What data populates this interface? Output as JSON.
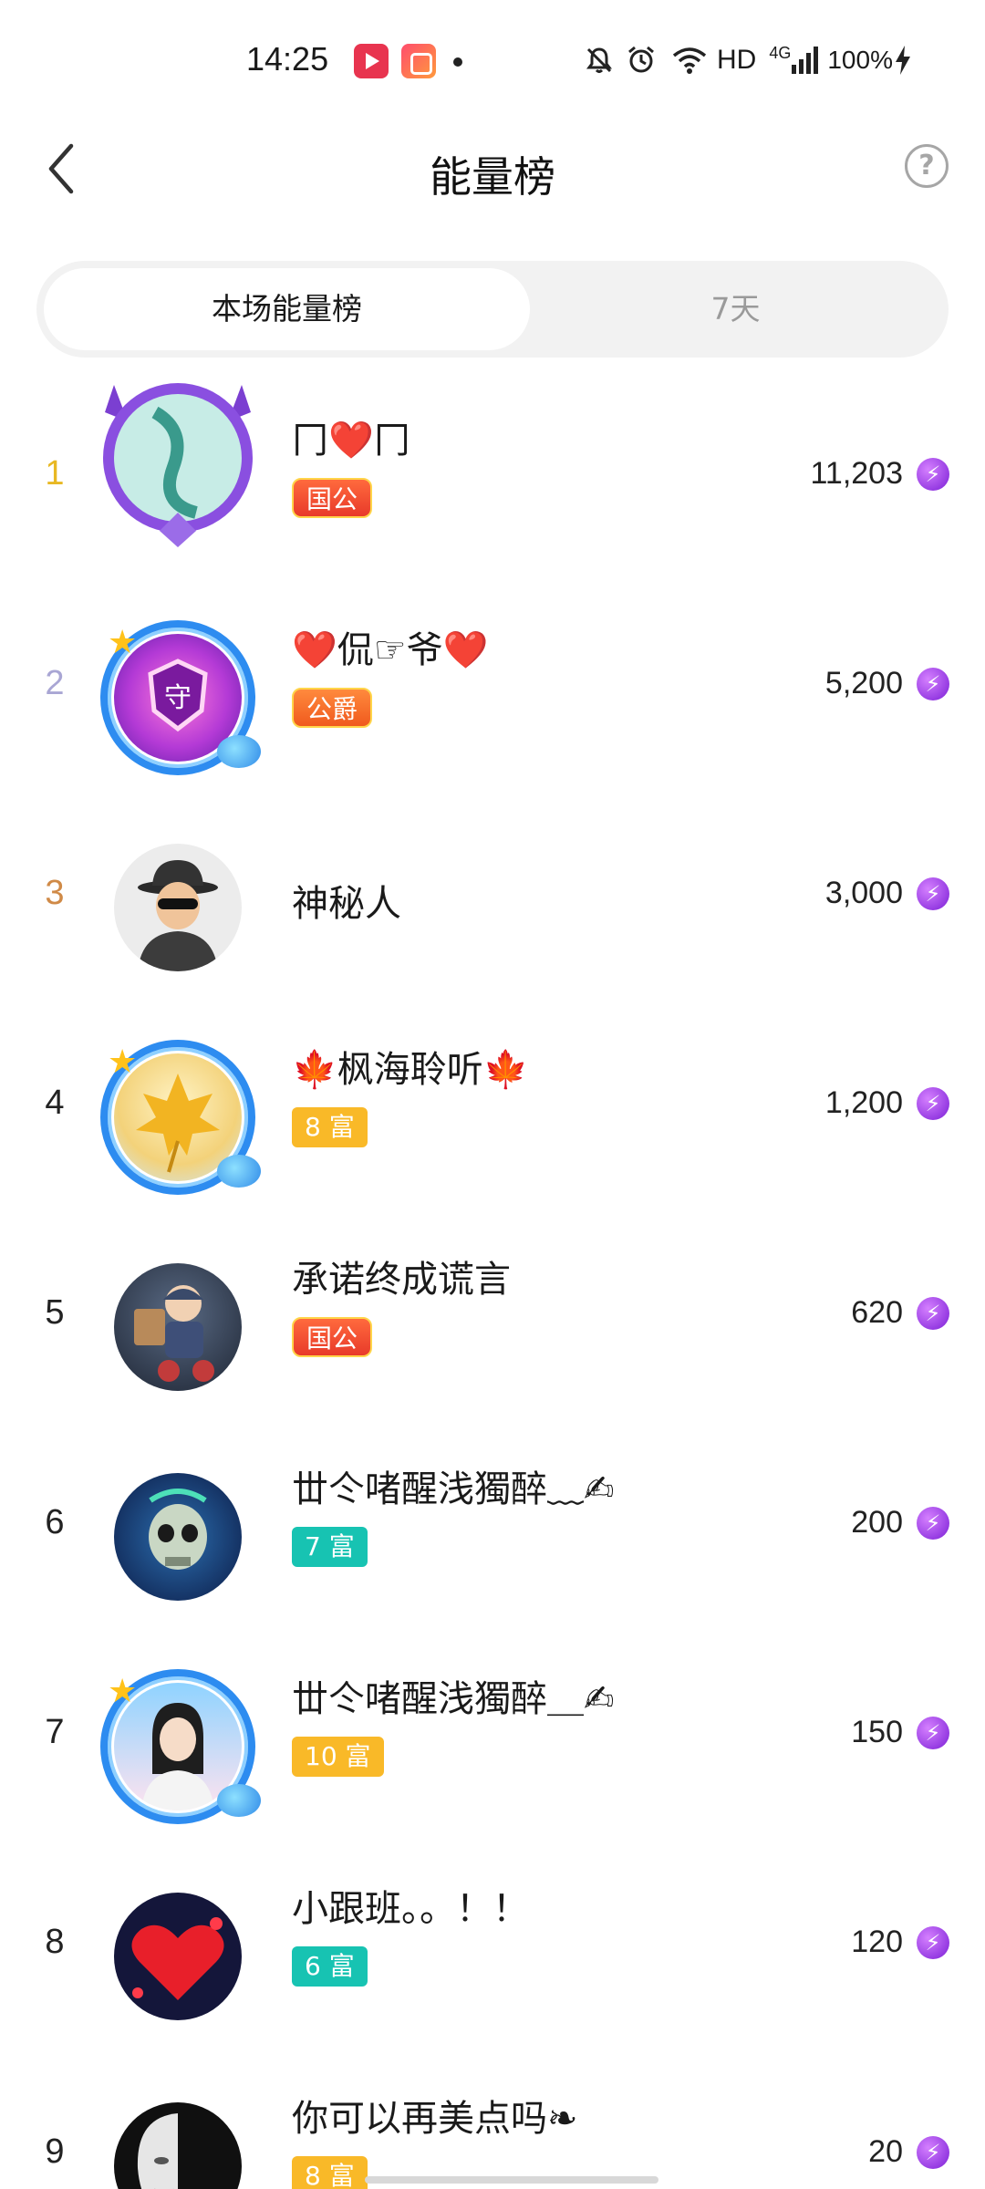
{
  "status_bar": {
    "time": "14:25",
    "network": "HD",
    "signal_label": "4G",
    "battery": "100%",
    "icons": [
      "video-app-icon",
      "media-app-icon",
      "notification-dot",
      "mute-icon",
      "alarm-icon",
      "wifi-icon",
      "signal-icon",
      "charging-icon"
    ]
  },
  "header": {
    "title": "能量榜",
    "back_icon": "chevron-left-icon",
    "help_label": "?"
  },
  "tabs": [
    {
      "label": "本场能量榜",
      "active": true
    },
    {
      "label": "7天",
      "active": false
    }
  ],
  "colors": {
    "rank1": "#e8b823",
    "rank2": "#a9a6d4",
    "rank3": "#d08a47",
    "energy": "#9b30e8",
    "badge_gold": "#f9b928",
    "badge_teal": "#17c3b2",
    "badge_red": "#e83a2a"
  },
  "list": [
    {
      "rank": "1",
      "name": "冂❤️冂",
      "badge": "国公",
      "score": "11,203"
    },
    {
      "rank": "2",
      "name": "❤️侃☞爷❤️",
      "badge": "公爵",
      "score": "5,200"
    },
    {
      "rank": "3",
      "name": "神秘人",
      "badge": "",
      "score": "3,000"
    },
    {
      "rank": "4",
      "name": "🍁枫海聆听🍁",
      "badge": "8 富",
      "score": "1,200"
    },
    {
      "rank": "5",
      "name": "承诺终成谎言",
      "badge": "国公",
      "score": "620"
    },
    {
      "rank": "6",
      "name": "丗仒啫醒浅獨醉﹏✍",
      "badge": "7 富",
      "score": "200"
    },
    {
      "rank": "7",
      "name": "丗仒啫醒浅獨醉＿✍",
      "badge": "10 富",
      "score": "150"
    },
    {
      "rank": "8",
      "name": "小跟班。。！！",
      "badge": "6 富",
      "score": "120"
    },
    {
      "rank": "9",
      "name": "你可以再美点吗❧",
      "badge": "8 富",
      "score": "20"
    }
  ],
  "energy_icon_glyph": "⚡"
}
